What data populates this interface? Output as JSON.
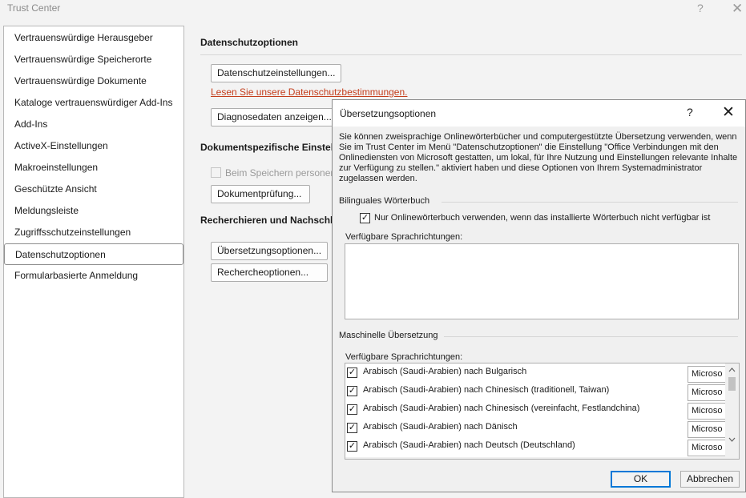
{
  "window": {
    "title": "Trust Center",
    "help": "?",
    "close": "✕"
  },
  "nav": {
    "items": [
      {
        "label": "Vertrauenswürdige Herausgeber"
      },
      {
        "label": "Vertrauenswürdige Speicherorte"
      },
      {
        "label": "Vertrauenswürdige Dokumente"
      },
      {
        "label": "Kataloge vertrauenswürdiger Add-Ins"
      },
      {
        "label": "Add-Ins"
      },
      {
        "label": "ActiveX-Einstellungen"
      },
      {
        "label": "Makroeinstellungen"
      },
      {
        "label": "Geschützte Ansicht"
      },
      {
        "label": "Meldungsleiste"
      },
      {
        "label": "Zugriffsschutzeinstellungen"
      },
      {
        "label": "Datenschutzoptionen",
        "selected": true
      },
      {
        "label": "Formularbasierte Anmeldung"
      }
    ]
  },
  "main": {
    "privacy_heading": "Datenschutzoptionen",
    "privacy_settings_button": "Datenschutzeinstellungen...",
    "privacy_link": "Lesen Sie unsere Datenschutzbestimmungen.",
    "diagnostics_button": "Diagnosedaten anzeigen...",
    "docspecific_heading": "Dokumentspezifische Einstell",
    "remove_personal_checkbox": "Beim Speichern personen",
    "doc_inspector_button": "Dokumentprüfung...",
    "research_heading": "Recherchieren und Nachschla",
    "translation_options_button": "Übersetzungsoptionen...",
    "research_options_button": "Rechercheoptionen..."
  },
  "dialog": {
    "title": "Übersetzungsoptionen",
    "help": "?",
    "close": "✕",
    "description": "Sie können zweisprachige Onlinewörterbücher und computergestützte Übersetzung verwenden, wenn Sie im Trust Center im Menü \"Datenschutzoptionen\" die Einstellung \"Office Verbindungen mit den Onlinediensten von Microsoft gestatten, um lokal, für Ihre Nutzung und Einstellungen relevante Inhalte zur Verfügung zu stellen.\" aktiviert haben und diese Optionen von Ihrem Systemadministrator zugelassen werden.",
    "bilingual_section": "Bilinguales Wörterbuch",
    "online_only_checkbox": "Nur Onlinewörterbuch verwenden, wenn das installierte Wörterbuch nicht verfügbar ist",
    "online_only_checked": true,
    "available_directions_label": "Verfügbare Sprachrichtungen:",
    "machine_section": "Maschinelle Übersetzung",
    "machine_directions_label": "Verfügbare Sprachrichtungen:",
    "languages": [
      {
        "label": "Arabisch (Saudi-Arabien) nach Bulgarisch",
        "checked": true,
        "provider": "Microso"
      },
      {
        "label": "Arabisch (Saudi-Arabien) nach Chinesisch (traditionell, Taiwan)",
        "checked": true,
        "provider": "Microso"
      },
      {
        "label": "Arabisch (Saudi-Arabien) nach Chinesisch (vereinfacht, Festlandchina)",
        "checked": true,
        "provider": "Microso"
      },
      {
        "label": "Arabisch (Saudi-Arabien) nach Dänisch",
        "checked": true,
        "provider": "Microso"
      },
      {
        "label": "Arabisch (Saudi-Arabien) nach Deutsch (Deutschland)",
        "checked": true,
        "provider": "Microso"
      }
    ],
    "ok_button": "OK",
    "cancel_button": "Abbrechen"
  }
}
